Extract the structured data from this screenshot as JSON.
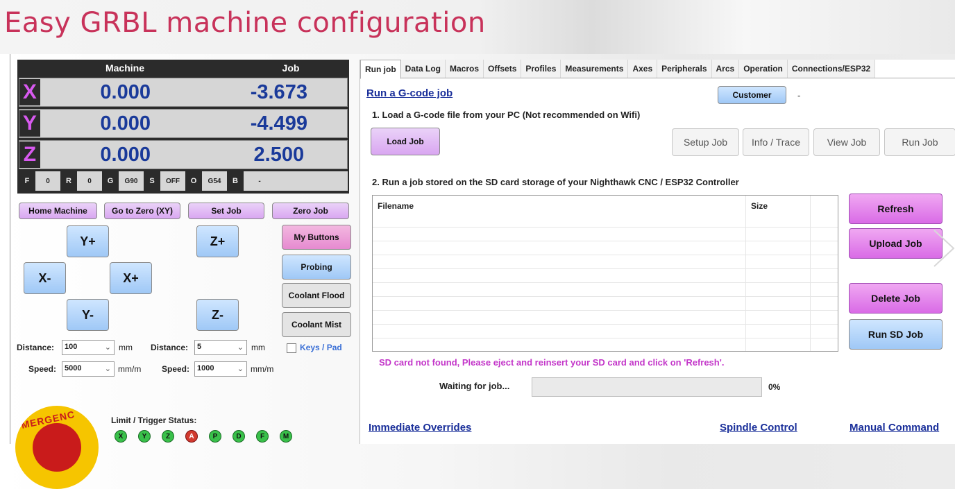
{
  "page_title": "Easy GRBL machine configuration",
  "dro": {
    "header_machine": "Machine",
    "header_job": "Job",
    "axes": [
      {
        "letter": "X",
        "machine": "0.000",
        "job": "-3.673"
      },
      {
        "letter": "Y",
        "machine": "0.000",
        "job": "-4.499"
      },
      {
        "letter": "Z",
        "machine": "0.000",
        "job": "2.500"
      }
    ],
    "status": {
      "f_label": "F",
      "f_value": "0",
      "r_label": "R",
      "r_value": "0",
      "g_label": "G",
      "g_value": "G90",
      "s_label": "S",
      "s_value": "OFF",
      "o_label": "O",
      "o_value": "G54",
      "b_label": "B",
      "b_value": "-"
    }
  },
  "actions": {
    "home_machine": "Home Machine",
    "go_to_zero": "Go to Zero (XY)",
    "set_job": "Set Job",
    "zero_job": "Zero Job"
  },
  "jog": {
    "y_plus": "Y+",
    "z_plus": "Z+",
    "x_minus": "X-",
    "x_plus": "X+",
    "y_minus": "Y-",
    "z_minus": "Z-"
  },
  "side_buttons": {
    "my_buttons": "My Buttons",
    "probing": "Probing",
    "coolant_flood": "Coolant Flood",
    "coolant_mist": "Coolant Mist",
    "keys_pad": "Keys / Pad"
  },
  "jog_settings": {
    "distance_label": "Distance:",
    "speed_label": "Speed:",
    "xy_distance": "100",
    "xy_speed": "5000",
    "z_distance": "5",
    "z_speed": "1000",
    "mm": "mm",
    "mmm": "mm/m"
  },
  "limit": {
    "title": "Limit / Trigger Status:",
    "indicators": [
      {
        "label": "X",
        "active": false
      },
      {
        "label": "Y",
        "active": false
      },
      {
        "label": "Z",
        "active": false
      },
      {
        "label": "A",
        "active": true
      },
      {
        "label": "P",
        "active": false
      },
      {
        "label": "D",
        "active": false
      },
      {
        "label": "F",
        "active": false
      },
      {
        "label": "M",
        "active": false
      }
    ]
  },
  "estop_text": "MERGENC",
  "tabs": [
    "Run job",
    "Data Log",
    "Macros",
    "Offsets",
    "Profiles",
    "Measurements",
    "Axes",
    "Peripherals",
    "Arcs",
    "Operation",
    "Connections/ESP32"
  ],
  "run_job": {
    "title": "Run a G-code job",
    "customer_button": "Customer",
    "customer_value": "-",
    "step1": "1. Load a G-code file from your PC (Not recommended on Wifi)",
    "load_job": "Load Job",
    "setup_job": "Setup Job",
    "info_trace": "Info / Trace",
    "view_job": "View Job",
    "run_job": "Run Job",
    "step2": "2. Run a job stored on the SD card storage of your Nighthawk CNC / ESP32 Controller",
    "col_filename": "Filename",
    "col_size": "Size",
    "refresh": "Refresh",
    "upload_job": "Upload Job",
    "delete_job": "Delete Job",
    "run_sd_job": "Run SD Job",
    "sd_message": "SD card not found, Please eject and reinsert your SD card and click on 'Refresh'.",
    "waiting": "Waiting for job...",
    "progress_percent": "0%",
    "progress_value": 0
  },
  "bottom_sections": {
    "immediate_overrides": "Immediate Overrides",
    "spindle_control": "Spindle Control",
    "manual_command": "Manual Command"
  },
  "colors": {
    "title": "#c8325a",
    "axis_letter": "#d85af0",
    "dro_value": "#1a3a9a",
    "sd_message": "#c336c9",
    "section_link": "#1a2f9a"
  }
}
